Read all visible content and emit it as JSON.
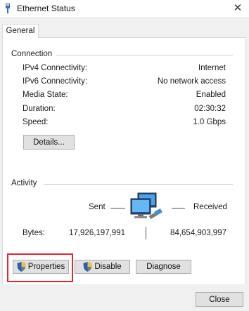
{
  "window": {
    "title": "Ethernet Status",
    "close_glyph": "✕"
  },
  "tabs": [
    {
      "label": "General"
    }
  ],
  "connection": {
    "heading": "Connection",
    "rows": [
      {
        "label": "IPv4 Connectivity:",
        "value": "Internet"
      },
      {
        "label": "IPv6 Connectivity:",
        "value": "No network access"
      },
      {
        "label": "Media State:",
        "value": "Enabled"
      },
      {
        "label": "Duration:",
        "value": "02:30:32"
      },
      {
        "label": "Speed:",
        "value": "1.0 Gbps"
      }
    ],
    "details_button": "Details..."
  },
  "activity": {
    "heading": "Activity",
    "sent_label": "Sent",
    "received_label": "Received",
    "bytes_label": "Bytes:",
    "bytes_sent": "17,926,197,991",
    "bytes_received": "84,654,903,997",
    "icon": "network-computers-icon"
  },
  "actions": {
    "properties": "Properties",
    "disable": "Disable",
    "diagnose": "Diagnose"
  },
  "footer": {
    "close": "Close"
  },
  "colors": {
    "highlight": "#e3262f",
    "button_face": "#e1e1e1",
    "button_border": "#adadad"
  }
}
